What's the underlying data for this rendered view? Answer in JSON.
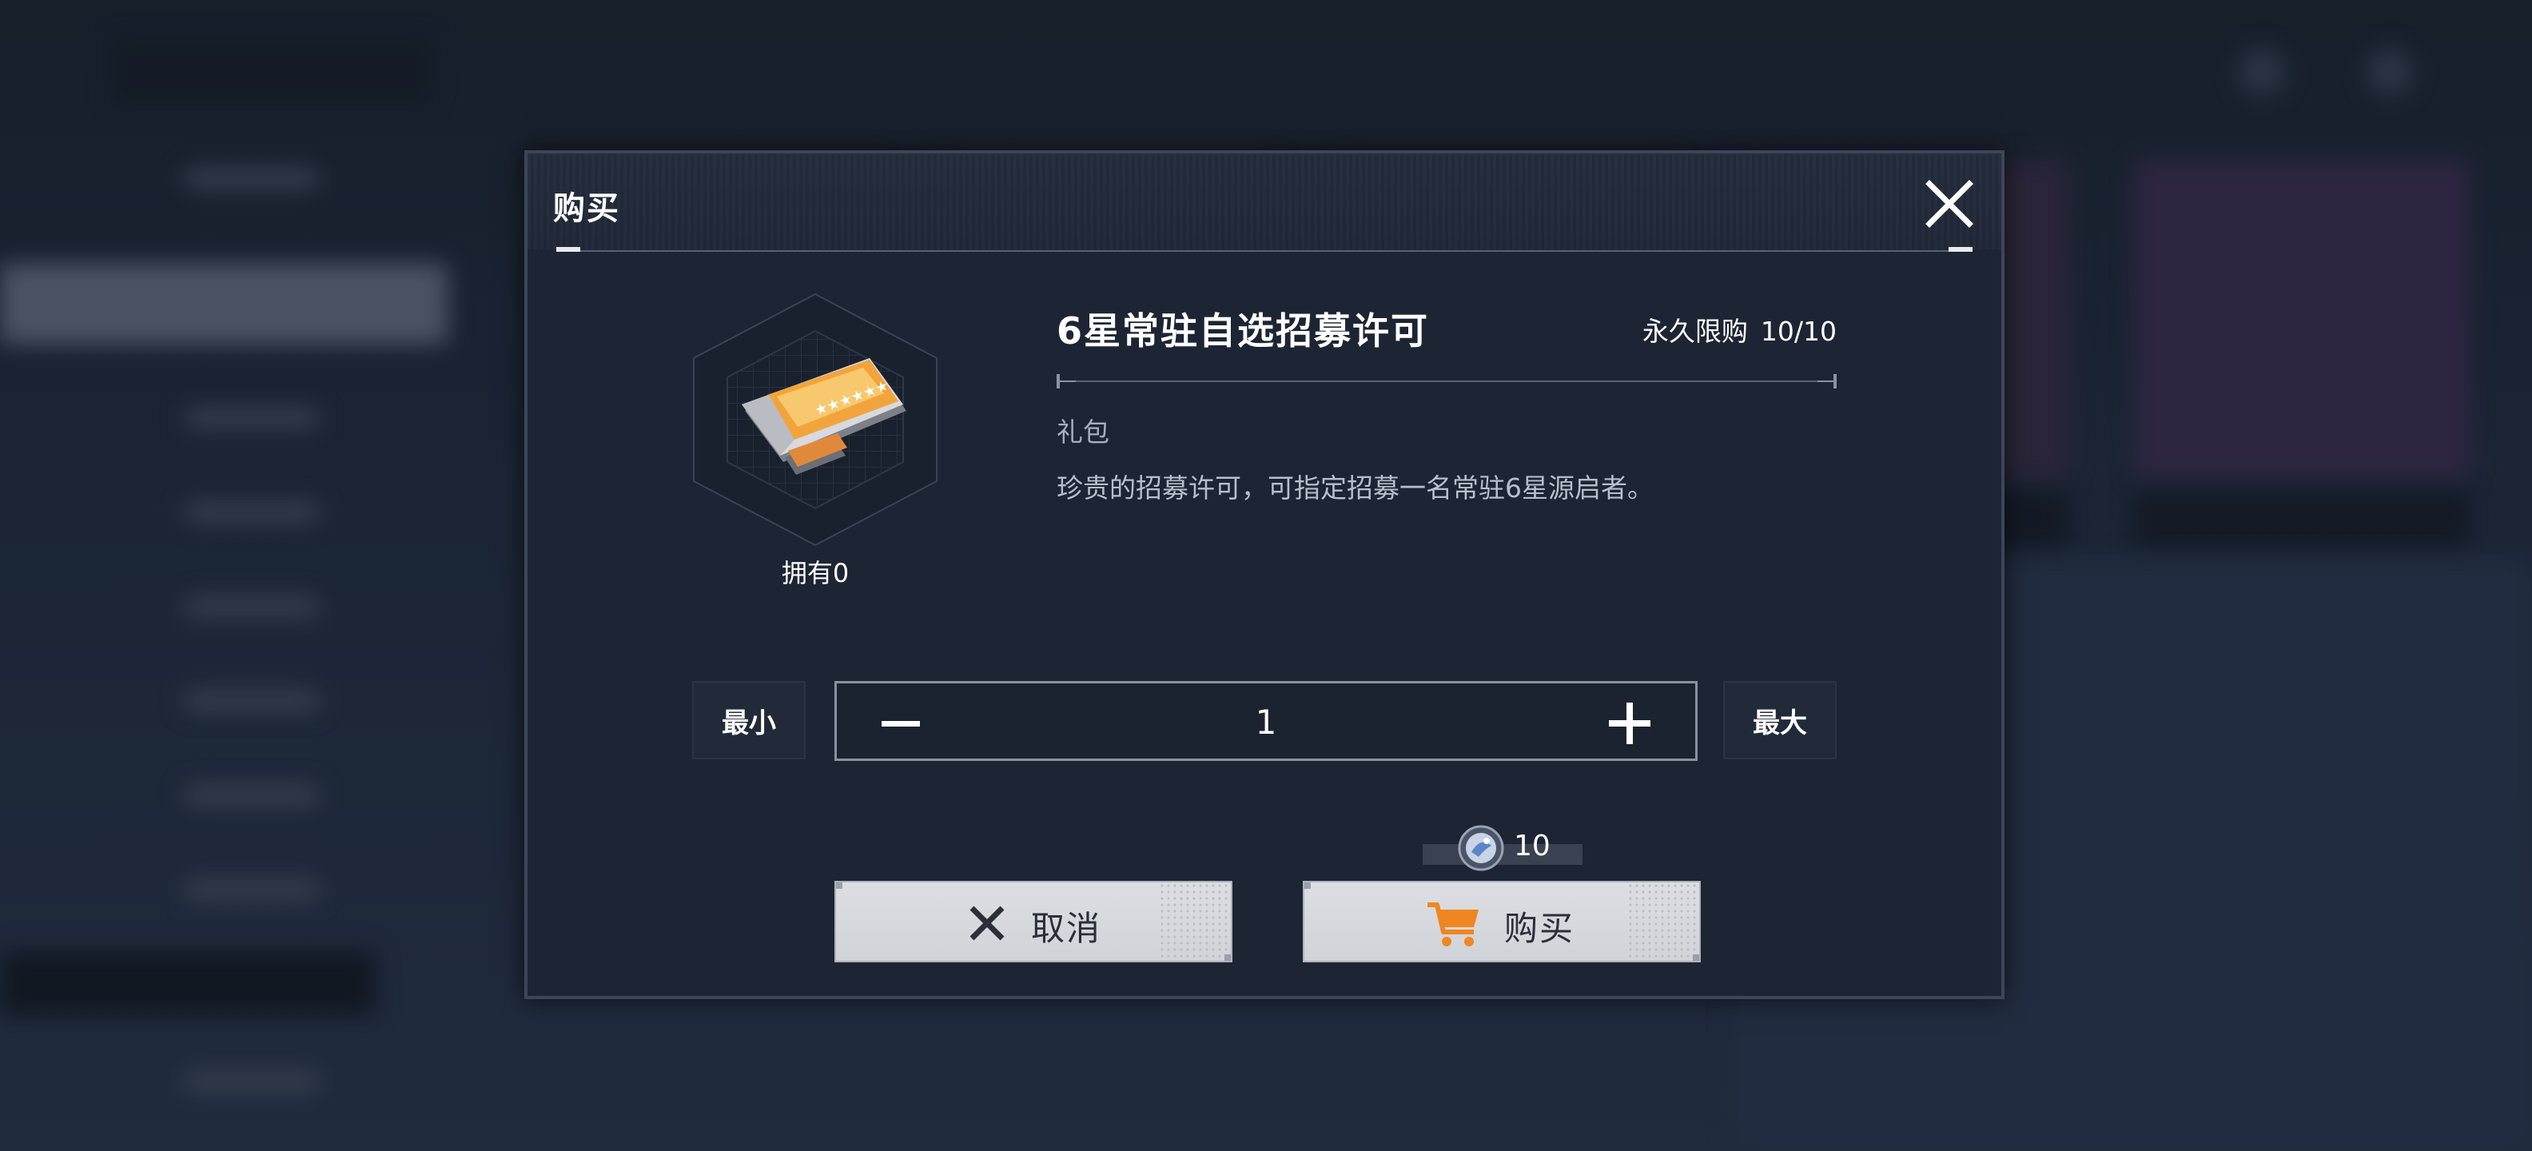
{
  "dialog": {
    "title": "购买",
    "close_icon": "close-icon"
  },
  "item": {
    "icon": "recruit-permit-ticket-icon",
    "owned_label": "拥有0",
    "name": "6星常驻自选招募许可",
    "limit_label": "永久限购",
    "limit_value": "10/10",
    "type": "礼包",
    "description": "珍贵的招募许可，可指定招募一名常驻6星源启者。"
  },
  "quantity": {
    "min_label": "最小",
    "max_label": "最大",
    "value": "1",
    "minus_icon": "minus-icon",
    "plus_icon": "plus-icon"
  },
  "price": {
    "currency_icon": "currency-coin-icon",
    "amount": "10"
  },
  "actions": {
    "cancel_label": "取消",
    "cancel_icon": "x-icon",
    "buy_label": "购买",
    "buy_icon": "shopping-cart-icon"
  },
  "colors": {
    "dialog_bg": "#1d2433",
    "button_bg": "#d8dadf",
    "cart_accent": "#f0861f",
    "text_primary": "#ffffff",
    "text_secondary": "#a7afbd"
  }
}
